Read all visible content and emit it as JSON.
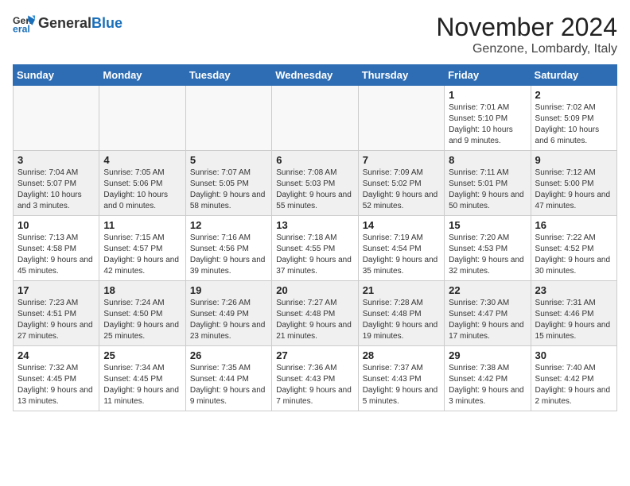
{
  "header": {
    "logo_general": "General",
    "logo_blue": "Blue",
    "month": "November 2024",
    "location": "Genzone, Lombardy, Italy"
  },
  "weekdays": [
    "Sunday",
    "Monday",
    "Tuesday",
    "Wednesday",
    "Thursday",
    "Friday",
    "Saturday"
  ],
  "weeks": [
    [
      {
        "day": "",
        "info": ""
      },
      {
        "day": "",
        "info": ""
      },
      {
        "day": "",
        "info": ""
      },
      {
        "day": "",
        "info": ""
      },
      {
        "day": "",
        "info": ""
      },
      {
        "day": "1",
        "info": "Sunrise: 7:01 AM\nSunset: 5:10 PM\nDaylight: 10 hours and 9 minutes."
      },
      {
        "day": "2",
        "info": "Sunrise: 7:02 AM\nSunset: 5:09 PM\nDaylight: 10 hours and 6 minutes."
      }
    ],
    [
      {
        "day": "3",
        "info": "Sunrise: 7:04 AM\nSunset: 5:07 PM\nDaylight: 10 hours and 3 minutes."
      },
      {
        "day": "4",
        "info": "Sunrise: 7:05 AM\nSunset: 5:06 PM\nDaylight: 10 hours and 0 minutes."
      },
      {
        "day": "5",
        "info": "Sunrise: 7:07 AM\nSunset: 5:05 PM\nDaylight: 9 hours and 58 minutes."
      },
      {
        "day": "6",
        "info": "Sunrise: 7:08 AM\nSunset: 5:03 PM\nDaylight: 9 hours and 55 minutes."
      },
      {
        "day": "7",
        "info": "Sunrise: 7:09 AM\nSunset: 5:02 PM\nDaylight: 9 hours and 52 minutes."
      },
      {
        "day": "8",
        "info": "Sunrise: 7:11 AM\nSunset: 5:01 PM\nDaylight: 9 hours and 50 minutes."
      },
      {
        "day": "9",
        "info": "Sunrise: 7:12 AM\nSunset: 5:00 PM\nDaylight: 9 hours and 47 minutes."
      }
    ],
    [
      {
        "day": "10",
        "info": "Sunrise: 7:13 AM\nSunset: 4:58 PM\nDaylight: 9 hours and 45 minutes."
      },
      {
        "day": "11",
        "info": "Sunrise: 7:15 AM\nSunset: 4:57 PM\nDaylight: 9 hours and 42 minutes."
      },
      {
        "day": "12",
        "info": "Sunrise: 7:16 AM\nSunset: 4:56 PM\nDaylight: 9 hours and 39 minutes."
      },
      {
        "day": "13",
        "info": "Sunrise: 7:18 AM\nSunset: 4:55 PM\nDaylight: 9 hours and 37 minutes."
      },
      {
        "day": "14",
        "info": "Sunrise: 7:19 AM\nSunset: 4:54 PM\nDaylight: 9 hours and 35 minutes."
      },
      {
        "day": "15",
        "info": "Sunrise: 7:20 AM\nSunset: 4:53 PM\nDaylight: 9 hours and 32 minutes."
      },
      {
        "day": "16",
        "info": "Sunrise: 7:22 AM\nSunset: 4:52 PM\nDaylight: 9 hours and 30 minutes."
      }
    ],
    [
      {
        "day": "17",
        "info": "Sunrise: 7:23 AM\nSunset: 4:51 PM\nDaylight: 9 hours and 27 minutes."
      },
      {
        "day": "18",
        "info": "Sunrise: 7:24 AM\nSunset: 4:50 PM\nDaylight: 9 hours and 25 minutes."
      },
      {
        "day": "19",
        "info": "Sunrise: 7:26 AM\nSunset: 4:49 PM\nDaylight: 9 hours and 23 minutes."
      },
      {
        "day": "20",
        "info": "Sunrise: 7:27 AM\nSunset: 4:48 PM\nDaylight: 9 hours and 21 minutes."
      },
      {
        "day": "21",
        "info": "Sunrise: 7:28 AM\nSunset: 4:48 PM\nDaylight: 9 hours and 19 minutes."
      },
      {
        "day": "22",
        "info": "Sunrise: 7:30 AM\nSunset: 4:47 PM\nDaylight: 9 hours and 17 minutes."
      },
      {
        "day": "23",
        "info": "Sunrise: 7:31 AM\nSunset: 4:46 PM\nDaylight: 9 hours and 15 minutes."
      }
    ],
    [
      {
        "day": "24",
        "info": "Sunrise: 7:32 AM\nSunset: 4:45 PM\nDaylight: 9 hours and 13 minutes."
      },
      {
        "day": "25",
        "info": "Sunrise: 7:34 AM\nSunset: 4:45 PM\nDaylight: 9 hours and 11 minutes."
      },
      {
        "day": "26",
        "info": "Sunrise: 7:35 AM\nSunset: 4:44 PM\nDaylight: 9 hours and 9 minutes."
      },
      {
        "day": "27",
        "info": "Sunrise: 7:36 AM\nSunset: 4:43 PM\nDaylight: 9 hours and 7 minutes."
      },
      {
        "day": "28",
        "info": "Sunrise: 7:37 AM\nSunset: 4:43 PM\nDaylight: 9 hours and 5 minutes."
      },
      {
        "day": "29",
        "info": "Sunrise: 7:38 AM\nSunset: 4:42 PM\nDaylight: 9 hours and 3 minutes."
      },
      {
        "day": "30",
        "info": "Sunrise: 7:40 AM\nSunset: 4:42 PM\nDaylight: 9 hours and 2 minutes."
      }
    ]
  ]
}
